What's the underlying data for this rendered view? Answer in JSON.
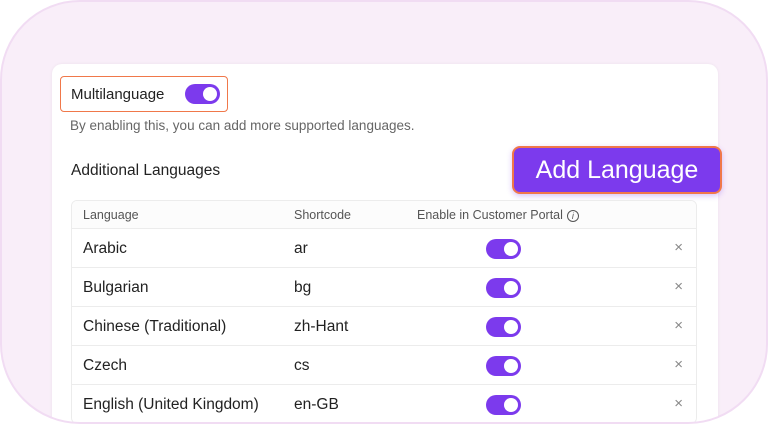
{
  "multilanguage": {
    "label": "Multilanguage",
    "enabled": true
  },
  "description": "By enabling this, you can  add more supported languages.",
  "section_title": "Additional Languages",
  "add_button": "Add Language",
  "table": {
    "headers": [
      "Language",
      "Shortcode",
      "Enable in Customer Portal"
    ],
    "info_icon": "i",
    "rows": [
      {
        "language": "Arabic",
        "code": "ar",
        "enabled": true,
        "remove": "×"
      },
      {
        "language": "Bulgarian",
        "code": "bg",
        "enabled": true,
        "remove": "×"
      },
      {
        "language": "Chinese (Traditional)",
        "code": "zh-Hant",
        "enabled": true,
        "remove": "×"
      },
      {
        "language": "Czech",
        "code": "cs",
        "enabled": true,
        "remove": "×"
      },
      {
        "language": "English (United Kingdom)",
        "code": "en-GB",
        "enabled": true,
        "remove": "×"
      }
    ]
  },
  "colors": {
    "accent": "#7c3aed",
    "highlight": "#f0784a"
  }
}
